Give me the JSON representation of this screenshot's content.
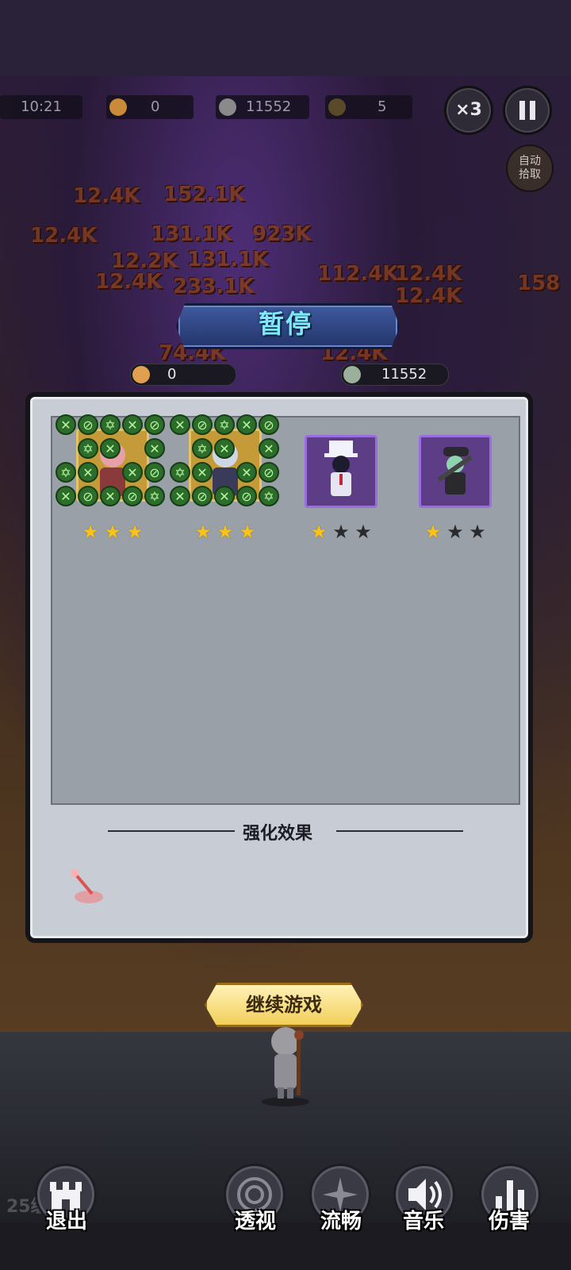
{
  "hud": {
    "timer": "10:21",
    "coins": "0",
    "kills": "11552",
    "boss_kills": "5",
    "speed_label": "×3",
    "auto_pickup_label": "自动拾取"
  },
  "background_damage_numbers": [
    "12.4K",
    "152.1K",
    "12.4K",
    "131.1K",
    "923K",
    "12.2K",
    "131.1K",
    "12.4K",
    "233.1K",
    "112.4K",
    "12.4K",
    "12.4K",
    "74.4K",
    "12.4K",
    "158"
  ],
  "pause": {
    "title": "暂停",
    "coins": "0",
    "kills": "11552"
  },
  "heroes": [
    {
      "stars_on": 3,
      "stars_total": 3
    },
    {
      "stars_on": 3,
      "stars_total": 3
    },
    {
      "stars_on": 1,
      "stars_total": 3
    },
    {
      "stars_on": 1,
      "stars_total": 3
    }
  ],
  "enhance": {
    "title": "强化效果"
  },
  "continue_label": "继续游戏",
  "player": {
    "level": "25级"
  },
  "menu": {
    "exit": "退出",
    "xray": "透视",
    "smooth": "流畅",
    "music": "音乐",
    "damage": "伤害"
  },
  "colors": {
    "title_text": "#7fe8ff",
    "star_on": "#f6c21b",
    "star_off": "#2b2b2e",
    "slot_purple": "#5c3d86",
    "slot_gold": "#c59b3a",
    "continue_gold": "#f2cf5a"
  }
}
